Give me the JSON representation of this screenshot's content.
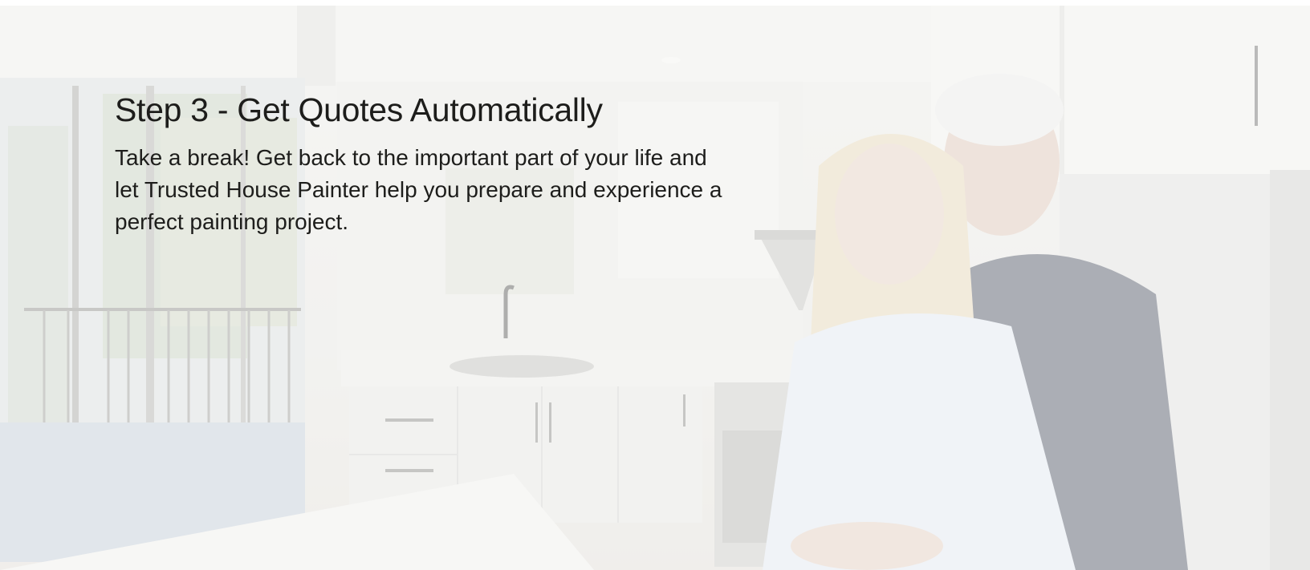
{
  "hero": {
    "title": "Step 3 - Get Quotes Automatically",
    "body": "Take a break! Get back to the important part of your life and let Trusted House Painter help you prepare and experience a perfect painting project.",
    "background_image": "kitchen-couple-photo"
  },
  "colors": {
    "text": "#1d1d1b",
    "overlay": "#f8f8f6"
  }
}
